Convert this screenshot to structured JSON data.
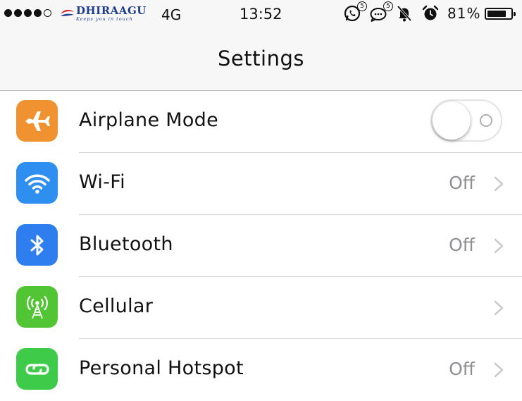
{
  "status_bar": {
    "signal_bars_filled": 4,
    "signal_bars_total": 5,
    "carrier_name": "DHIRAAGU",
    "carrier_tagline": "Keeps you in touch",
    "network": "4G",
    "time": "13:52",
    "whatsapp_badge": "5",
    "messenger_badge": "5",
    "battery_percent": "81%",
    "battery_level": 0.81,
    "icons": [
      "whatsapp-icon",
      "chat-icon",
      "bell-mute-icon",
      "alarm-icon",
      "battery-icon"
    ]
  },
  "nav": {
    "title": "Settings"
  },
  "rows": [
    {
      "label": "Airplane Mode",
      "icon": "airplane-icon",
      "color": "#f0922f",
      "control": "toggle",
      "toggle_on": false
    },
    {
      "label": "Wi-Fi",
      "icon": "wifi-icon",
      "color": "#2f8ff0",
      "value": "Off"
    },
    {
      "label": "Bluetooth",
      "icon": "bluetooth-icon",
      "color": "#2f7ef0",
      "value": "Off"
    },
    {
      "label": "Cellular",
      "icon": "cellular-icon",
      "color": "#52c535",
      "value": ""
    },
    {
      "label": "Personal Hotspot",
      "icon": "hotspot-icon",
      "color": "#3ecb4a",
      "value": "Off"
    }
  ],
  "colors": {
    "bar_background": "#f7f7f8",
    "separator": "#d4d4d8",
    "secondary_text": "#8e8e93",
    "chevron": "#c7c7cc"
  }
}
